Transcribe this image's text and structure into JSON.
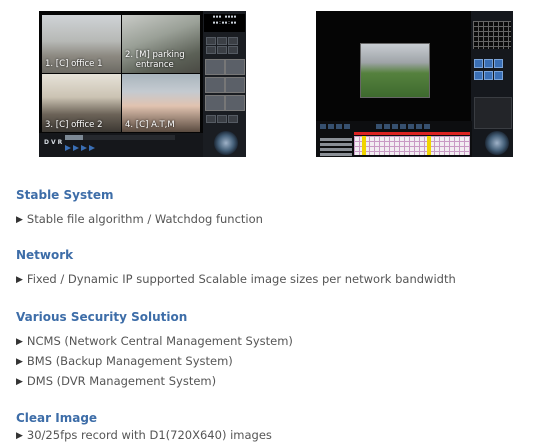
{
  "screenshot_left": {
    "cameras": [
      {
        "label": "1. [C] office 1"
      },
      {
        "label": "2. [M] parking\n    entrance"
      },
      {
        "label": "3. [C] office 2"
      },
      {
        "label": "4. [C] A.T,M"
      }
    ],
    "brand": "DVR"
  },
  "sections": [
    {
      "title": "Stable System",
      "items": [
        "Stable file algorithm / Watchdog function"
      ]
    },
    {
      "title": "Network",
      "items": [
        "Fixed / Dynamic IP supported Scalable image sizes per network bandwidth"
      ]
    },
    {
      "title": "Various Security Solution",
      "items": [
        "NCMS (Network Central Management System)",
        "BMS (Backup Management System)",
        "DMS (DVR Management System)"
      ]
    },
    {
      "title": "Clear Image",
      "items": [
        "30/25fps record with D1(720X640) images"
      ]
    }
  ],
  "bullet_glyph": "▶",
  "colors": {
    "heading": "#3d6da8",
    "body_text": "#555555",
    "screen_bg": "#050505",
    "accent_blue": "#3a6fb5"
  }
}
